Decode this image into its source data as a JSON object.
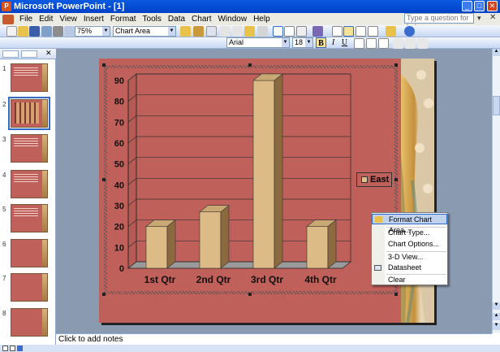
{
  "window": {
    "title": "Microsoft PowerPoint - [1]"
  },
  "menu": [
    "File",
    "Edit",
    "View",
    "Insert",
    "Format",
    "Tools",
    "Data",
    "Chart",
    "Window",
    "Help"
  ],
  "help": {
    "placeholder": "Type a question for help"
  },
  "toolbar": {
    "zoom": "75%",
    "chart_object": "Chart Area",
    "font": "Arial",
    "font_size": "18",
    "bold": "B",
    "italic": "I",
    "underline": "U"
  },
  "slides": [
    {
      "num": "1"
    },
    {
      "num": "2"
    },
    {
      "num": "3"
    },
    {
      "num": "4"
    },
    {
      "num": "5"
    },
    {
      "num": "6"
    },
    {
      "num": "7"
    },
    {
      "num": "8"
    }
  ],
  "context_menu": {
    "items": [
      "Format Chart Area...",
      "Chart Type...",
      "Chart Options...",
      "3-D View...",
      "Datasheet",
      "Clear"
    ]
  },
  "notes": {
    "placeholder": "Click to add notes"
  },
  "colors": {
    "slide_bg": "#c0605a",
    "bar": "#dcbb86",
    "bar_side": "#8a6a3e",
    "bar_top": "#c8a873"
  },
  "chart_data": {
    "type": "bar",
    "categories": [
      "1st Qtr",
      "2nd Qtr",
      "3rd Qtr",
      "4th Qtr"
    ],
    "series": [
      {
        "name": "East",
        "values": [
          20,
          27,
          90,
          20
        ]
      }
    ],
    "ylim": [
      0,
      90
    ],
    "yticks": [
      "0",
      "10",
      "20",
      "30",
      "40",
      "50",
      "60",
      "70",
      "80",
      "90"
    ],
    "grid": true,
    "legend": "right",
    "three_d": true
  }
}
